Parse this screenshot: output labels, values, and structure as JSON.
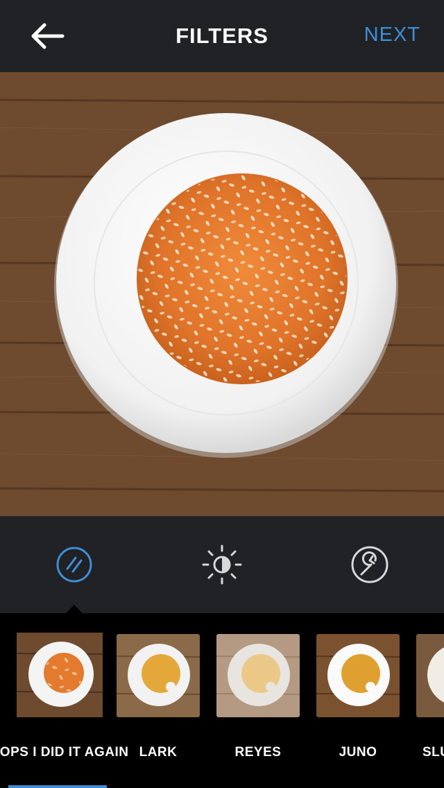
{
  "header": {
    "title": "FILTERS",
    "next_label": "NEXT"
  },
  "tools": [
    "filter-tool-icon",
    "brightness-icon",
    "adjust-wrench-icon"
  ],
  "filters": [
    {
      "label": "OOPS I DID IT AGAIN",
      "selected": true
    },
    {
      "label": "LARK",
      "selected": false
    },
    {
      "label": "REYES",
      "selected": false
    },
    {
      "label": "JUNO",
      "selected": false
    },
    {
      "label": "SLU",
      "selected": false
    }
  ],
  "colors": {
    "accent": "#3f8ed8",
    "bar": "#202226",
    "wood": "#6e4a2e"
  }
}
